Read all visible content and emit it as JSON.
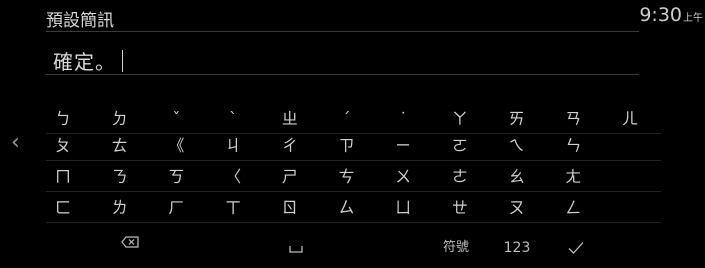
{
  "header": {
    "title": "預設簡訊",
    "time": "9:30",
    "ampm": "上午"
  },
  "input": {
    "value": "確定。"
  },
  "keyboard": {
    "prev_page_glyph": "‹",
    "rows": [
      [
        "ㄅ",
        "ㄉ",
        "ˇ",
        "ˋ",
        "ㄓ",
        "ˊ",
        "˙",
        "ㄚ",
        "ㄞ",
        "ㄢ",
        "ㄦ"
      ],
      [
        "ㄆ",
        "ㄊ",
        "《",
        "ㄐ",
        "ㄔ",
        "ㄗ",
        "ㄧ",
        "ㄛ",
        "ㄟ",
        "ㄣ"
      ],
      [
        "ㄇ",
        "ㄋ",
        "ㄎ",
        "〈",
        "ㄕ",
        "ㄘ",
        "ㄨ",
        "ㄜ",
        "ㄠ",
        "ㄤ"
      ],
      [
        "ㄈ",
        "ㄌ",
        "ㄏ",
        "ㄒ",
        "ㄖ",
        "ㄙ",
        "ㄩ",
        "ㄝ",
        "ㄡ",
        "ㄥ"
      ]
    ],
    "bottom": {
      "backspace_icon": "backspace-icon",
      "space_icon": "space-icon",
      "symbols_label": "符號",
      "numbers_label": "123",
      "confirm_icon": "checkmark-icon"
    }
  }
}
